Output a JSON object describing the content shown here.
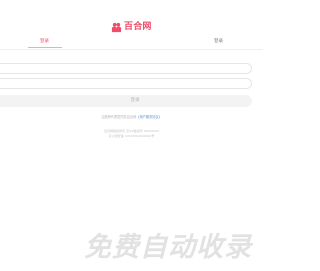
{
  "brand": {
    "logo_text": "百合网",
    "logo_icon": "lily-couple-icon",
    "accent_color": "#f04d6b"
  },
  "tabs": [
    {
      "label": "登录",
      "active": true
    },
    {
      "label": "登录",
      "active": false
    }
  ],
  "form": {
    "username": {
      "value": "",
      "placeholder": ""
    },
    "password": {
      "value": "",
      "placeholder": ""
    },
    "login_button": "登录"
  },
  "agreement": {
    "prefix": "注册即代表您同意百合网",
    "link": "《用户服务协议》"
  },
  "footer": {
    "line1": "百合网版权所有 京ICP备案号 00000000",
    "line2": "京公网安备 11010502000000号"
  },
  "watermark": {
    "text": "免费自动收录"
  }
}
